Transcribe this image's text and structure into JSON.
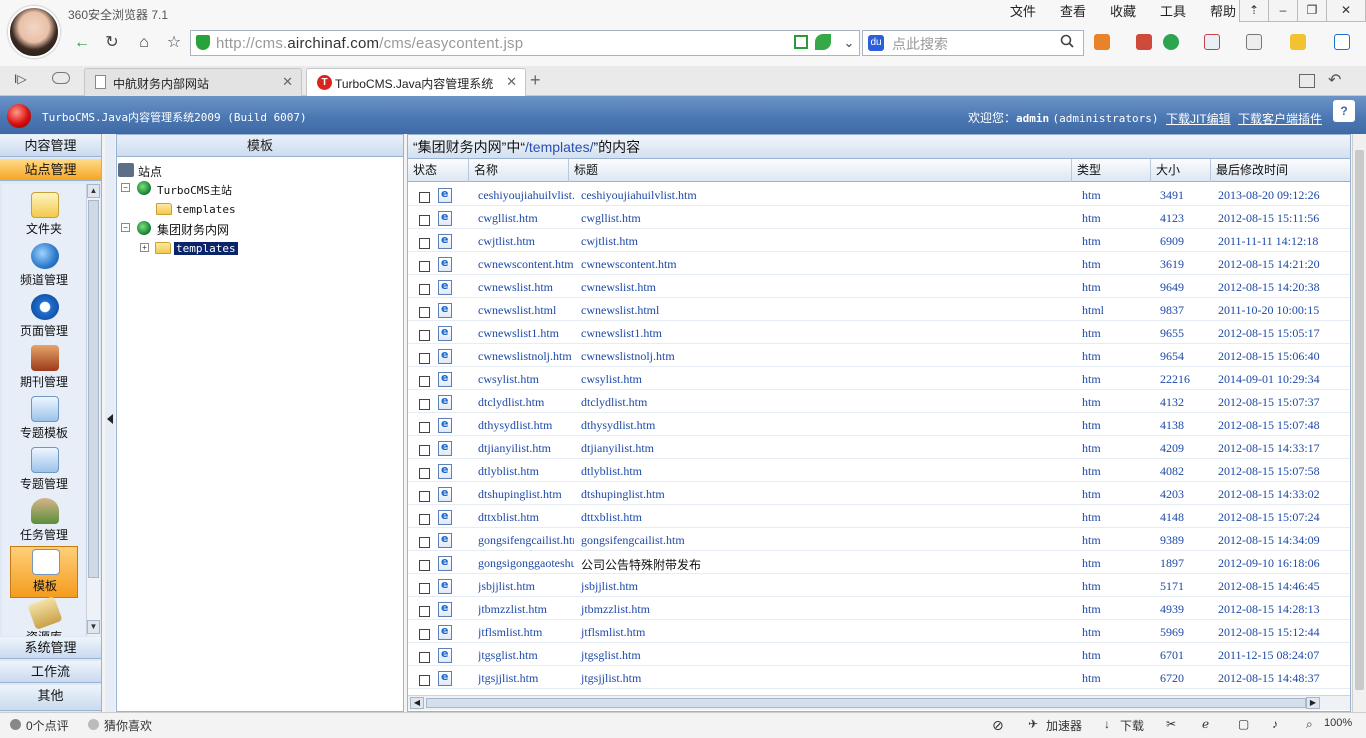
{
  "browser": {
    "app_title": "360安全浏览器 7.1",
    "menu": [
      "文件",
      "查看",
      "收藏",
      "工具",
      "帮助"
    ],
    "window_buttons": [
      "⇡",
      "–",
      "❐",
      "✕"
    ],
    "url_prefix": "http://cms.",
    "url_domain": "airchinaf.com",
    "url_suffix": "/cms/easycontent.jsp",
    "search_placeholder": "点此搜索",
    "tabs": [
      {
        "label": "中航财务内部网站",
        "active": false
      },
      {
        "label": "TurboCMS.Java内容管理系统",
        "active": true
      }
    ]
  },
  "cms": {
    "title": "TurboCMS.Java内容管理系统2009 (Build 6007)",
    "welcome_prefix": "欢迎您：",
    "username": "admin",
    "role": "(administrators)",
    "link_download_edit": "下载JIT编辑",
    "link_download_plugin": "下载客户端插件"
  },
  "left_nav": {
    "categories_top": [
      "内容管理",
      "站点管理"
    ],
    "categories_bottom": [
      "系统管理",
      "工作流",
      "其他"
    ],
    "items": [
      {
        "label": "文件夹",
        "icon": "folder-icon",
        "color": "#f4d36b"
      },
      {
        "label": "频道管理",
        "icon": "globe-icon",
        "color": "#3b8fd9"
      },
      {
        "label": "页面管理",
        "icon": "ie-icon",
        "color": "#1f6fd1"
      },
      {
        "label": "期刊管理",
        "icon": "magazine-icon",
        "color": "#b5542a"
      },
      {
        "label": "专题模板",
        "icon": "template-star-icon",
        "color": "#9bc3ea"
      },
      {
        "label": "专题管理",
        "icon": "topic-star-icon",
        "color": "#9bc3ea"
      },
      {
        "label": "任务管理",
        "icon": "users-icon",
        "color": "#5b8f3a"
      },
      {
        "label": "模板",
        "icon": "template-doc-icon",
        "color": "#ffffff"
      },
      {
        "label": "资源库",
        "icon": "book-icon",
        "color": "#c9a24a"
      }
    ]
  },
  "tree": {
    "header": "模板",
    "root": "站点",
    "site1": "TurboCMS主站",
    "site1_child": "templates",
    "site2": "集团财务内网",
    "site2_child": "templates"
  },
  "content": {
    "title_prefix": "“集团财务内网”中“",
    "title_path": "/templates/",
    "title_suffix": "”的内容",
    "columns": [
      "状态",
      "名称",
      "标题",
      "类型",
      "大小",
      "最后修改时间"
    ],
    "rows": [
      {
        "name": "ceshiyoujiahuilvlist.htm",
        "title": "ceshiyoujiahuilvlist.htm",
        "type": "htm",
        "size": "3491",
        "date": "2013-08-20 09:12:26"
      },
      {
        "name": "cwgllist.htm",
        "title": "cwgllist.htm",
        "type": "htm",
        "size": "4123",
        "date": "2012-08-15 15:11:56"
      },
      {
        "name": "cwjtlist.htm",
        "title": "cwjtlist.htm",
        "type": "htm",
        "size": "6909",
        "date": "2011-11-11 14:12:18"
      },
      {
        "name": "cwnewscontent.htm",
        "title": "cwnewscontent.htm",
        "type": "htm",
        "size": "3619",
        "date": "2012-08-15 14:21:20"
      },
      {
        "name": "cwnewslist.htm",
        "title": "cwnewslist.htm",
        "type": "htm",
        "size": "9649",
        "date": "2012-08-15 14:20:38"
      },
      {
        "name": "cwnewslist.html",
        "title": "cwnewslist.html",
        "type": "html",
        "size": "9837",
        "date": "2011-10-20 10:00:15"
      },
      {
        "name": "cwnewslist1.htm",
        "title": "cwnewslist1.htm",
        "type": "htm",
        "size": "9655",
        "date": "2012-08-15 15:05:17"
      },
      {
        "name": "cwnewslistnolj.htm",
        "title": "cwnewslistnolj.htm",
        "type": "htm",
        "size": "9654",
        "date": "2012-08-15 15:06:40"
      },
      {
        "name": "cwsylist.htm",
        "title": "cwsylist.htm",
        "type": "htm",
        "size": "22216",
        "date": "2014-09-01 10:29:34"
      },
      {
        "name": "dtclydlist.htm",
        "title": "dtclydlist.htm",
        "type": "htm",
        "size": "4132",
        "date": "2012-08-15 15:07:37"
      },
      {
        "name": "dthysydlist.htm",
        "title": "dthysydlist.htm",
        "type": "htm",
        "size": "4138",
        "date": "2012-08-15 15:07:48"
      },
      {
        "name": "dtjianyilist.htm",
        "title": "dtjianyilist.htm",
        "type": "htm",
        "size": "4209",
        "date": "2012-08-15 14:33:17"
      },
      {
        "name": "dtlyblist.htm",
        "title": "dtlyblist.htm",
        "type": "htm",
        "size": "4082",
        "date": "2012-08-15 15:07:58"
      },
      {
        "name": "dtshupinglist.htm",
        "title": "dtshupinglist.htm",
        "type": "htm",
        "size": "4203",
        "date": "2012-08-15 14:33:02"
      },
      {
        "name": "dttxblist.htm",
        "title": "dttxblist.htm",
        "type": "htm",
        "size": "4148",
        "date": "2012-08-15 15:07:24"
      },
      {
        "name": "gongsifengcailist.htm",
        "title": "gongsifengcailist.htm",
        "type": "htm",
        "size": "9389",
        "date": "2012-08-15 14:34:09"
      },
      {
        "name": "gongsigonggaoteshu.htm",
        "title": "公司公告特殊附带发布",
        "type": "htm",
        "size": "1897",
        "date": "2012-09-10 16:18:06"
      },
      {
        "name": "jsbjjlist.htm",
        "title": "jsbjjlist.htm",
        "type": "htm",
        "size": "5171",
        "date": "2012-08-15 14:46:45"
      },
      {
        "name": "jtbmzzlist.htm",
        "title": "jtbmzzlist.htm",
        "type": "htm",
        "size": "4939",
        "date": "2012-08-15 14:28:13"
      },
      {
        "name": "jtflsmlist.htm",
        "title": "jtflsmlist.htm",
        "type": "htm",
        "size": "5969",
        "date": "2012-08-15 15:12:44"
      },
      {
        "name": "jtgsglist.htm",
        "title": "jtgsglist.htm",
        "type": "htm",
        "size": "6701",
        "date": "2011-12-15 08:24:07"
      },
      {
        "name": "jtgsjjlist.htm",
        "title": "jtgsjjlist.htm",
        "type": "htm",
        "size": "6720",
        "date": "2012-08-15 14:48:37"
      }
    ]
  },
  "status_bar": {
    "comments": "0个点评",
    "guess": "猜你喜欢",
    "accelerator": "加速器",
    "download": "下载",
    "zoom": "100%"
  }
}
